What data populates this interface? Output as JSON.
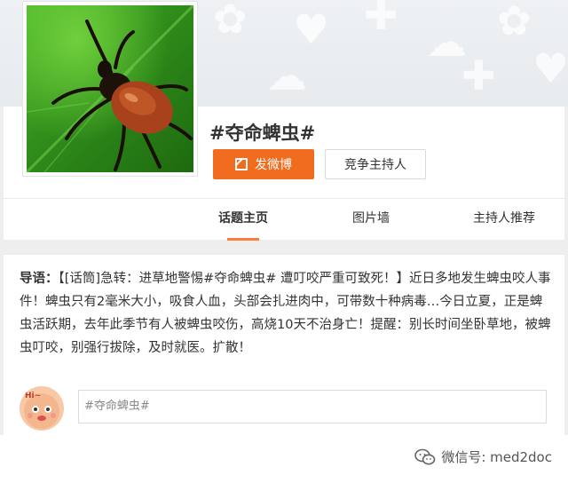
{
  "topic": {
    "title": "#夺命蜱虫#"
  },
  "buttons": {
    "post": "发微博",
    "host": "竞争主持人"
  },
  "tabs": [
    {
      "label": "话题主页",
      "active": true
    },
    {
      "label": "图片墙",
      "active": false
    },
    {
      "label": "主持人推荐",
      "active": false
    }
  ],
  "intro": {
    "lead": "导语：",
    "body": "【[话筒]急转：进草地警惕#夺命蜱虫# 遭叮咬严重可致死！】近日多地发生蜱虫咬人事件！蜱虫只有2毫米大小，吸食人血，头部会扎进肉中，可带数十种病毒…今日立夏，正是蜱虫活跃期，去年此季节有人被蜱虫咬伤，高烧10天不治身亡！提醒：别长时间坐卧草地，被蜱虫叮咬，别强行拔除，及时就医。扩散！"
  },
  "compose": {
    "value": "#夺命蜱虫#",
    "avatar_text": "Hi~"
  },
  "watermark": {
    "text": "微信号: med2doc"
  },
  "colors": {
    "accent": "#f26c1f",
    "tab_underline": "#fa7d3c",
    "leaf_green": "#3a9a20"
  }
}
